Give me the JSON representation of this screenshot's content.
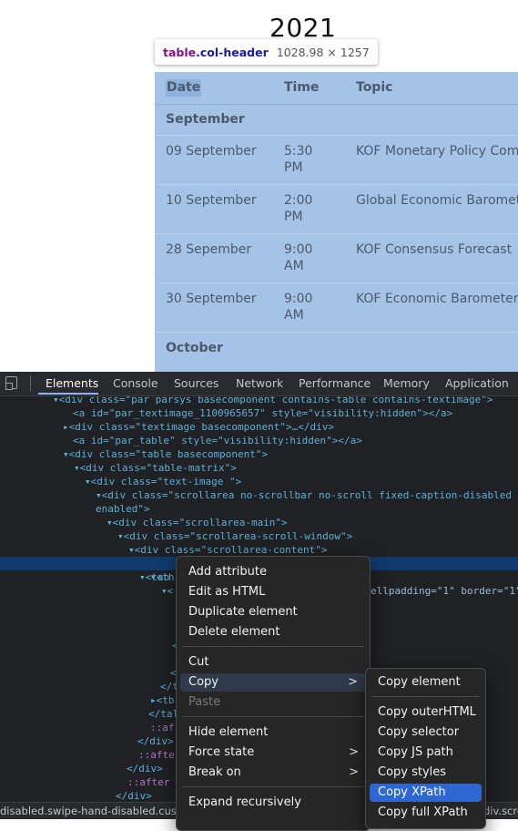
{
  "page": {
    "year": "2021",
    "tooltip": {
      "tag": "table",
      "class_name": ".col-header",
      "dimensions": "1028.98 × 1257"
    },
    "table": {
      "headers": [
        "Date",
        "Time",
        "Topic"
      ],
      "months": [
        "September",
        "October"
      ],
      "rows": [
        {
          "date": "09 September",
          "time_1": "5:30",
          "time_2": "PM",
          "topic": "KOF Monetary Policy Comm"
        },
        {
          "date": "10 September",
          "time_1": "2:00",
          "time_2": "PM",
          "topic": "Global Economic Baromet"
        },
        {
          "date": "28 Sepember",
          "time_1": "9:00",
          "time_2": "AM",
          "topic": "KOF Consensus Forecast"
        },
        {
          "date": "30 September",
          "time_1": "9:00",
          "time_2": "AM",
          "topic": "KOF Economic Barometer"
        }
      ]
    }
  },
  "devtools": {
    "tabs": [
      "Elements",
      "Console",
      "Sources",
      "Network",
      "Performance",
      "Memory",
      "Application"
    ],
    "active_tab": "Elements",
    "dom": {
      "l0": "▾<div class=\"par parsys basecomponent contains-table contains-textimage\">",
      "l1_a": "<a id=\"par_textimage_1100965657\" style=\"visibility:hidden\"></a>",
      "l2_a": "▸<div class=\"textimage basecomponent\">…</div>",
      "l3_a": "<a id=\"par_table\" style=\"visibility:hidden\"></a>",
      "l4": "▾<div class=\"table basecomponent\">",
      "l5": "▾<div class=\"table-matrix\">",
      "l6": "▾<div class=\"text-image \">",
      "l7": "▾<div class=\"scrollarea no-scrollbar no-scroll fixed-caption-disabled",
      "l7b": "enabled\">",
      "l8": "▾<div class=\"scrollarea-main\">",
      "l9": "▾<div class=\"scrollarea-scroll-window\">",
      "l10": "▾<div class=\"scrollarea-content\">",
      "l11_left": "▾<tab",
      "l11_right": "ellpadding=\"1\" border=\"1\"",
      "l12": "▾<th",
      "l13": "▾<",
      "l14": "<",
      "l15": "<",
      "l16": "</t",
      "l17": "▸<tb",
      "l18": "</tal",
      "l19": "::af",
      "l20": "</div>",
      "l21": "::afte",
      "l22": "</div>",
      "l23": "::after",
      "l24": "</div>"
    },
    "breadcrumbs": {
      "left": "disabled.swipe-hand-disabled.custo",
      "right": "div.scro"
    }
  },
  "context_menu": {
    "items": [
      {
        "label": "Add attribute",
        "enabled": true
      },
      {
        "label": "Edit as HTML",
        "enabled": true
      },
      {
        "label": "Duplicate element",
        "enabled": true
      },
      {
        "label": "Delete element",
        "enabled": true
      },
      {
        "label": "Cut",
        "enabled": true
      },
      {
        "label": "Copy",
        "enabled": true,
        "submenu": true,
        "highlighted": true
      },
      {
        "label": "Paste",
        "enabled": false
      },
      {
        "label": "Hide element",
        "enabled": true
      },
      {
        "label": "Force state",
        "enabled": true,
        "submenu": true
      },
      {
        "label": "Break on",
        "enabled": true,
        "submenu": true
      },
      {
        "label": "Expand recursively",
        "enabled": true
      }
    ],
    "arrow": ">"
  },
  "copy_submenu": {
    "items": [
      {
        "label": "Copy element"
      },
      {
        "label": "Copy outerHTML"
      },
      {
        "label": "Copy selector"
      },
      {
        "label": "Copy JS path"
      },
      {
        "label": "Copy styles"
      },
      {
        "label": "Copy XPath",
        "selected": true
      },
      {
        "label": "Copy full XPath"
      }
    ]
  },
  "colors": {
    "table_highlight": "#a4c3e6",
    "devtools_bg": "#202124",
    "selection_blue": "#2d67d4",
    "tag_blue": "#5db0d7",
    "attr_value_orange": "#f29766"
  },
  "icons": [
    "device-toolbar-icon",
    "submenu-arrow-icon"
  ]
}
